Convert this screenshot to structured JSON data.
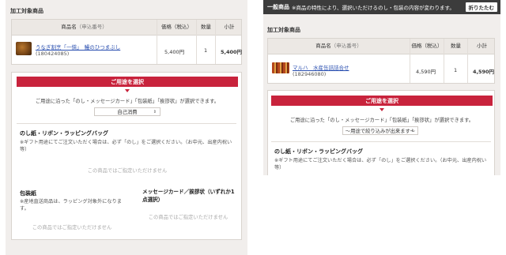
{
  "left": {
    "section_title": "加工対象商品",
    "table": {
      "headers": {
        "product": "商品名",
        "product_sub": "（申込番号）",
        "price": "価格（税込）",
        "qty": "数量",
        "subtotal": "小計"
      },
      "row": {
        "name": "うなぎ割烹「一愼」　鰻のひつまぶし",
        "code": "(180424085)",
        "price": "5,400円",
        "qty": "1",
        "subtotal": "5,400円"
      }
    },
    "purpose": {
      "button": "ご用途を選択",
      "description": "ご用途に沿った「のし・メッセージカード」「包装紙」「挨拶状」が選択できます。",
      "select_value": "自己消費"
    },
    "noshi": {
      "heading": "のし紙・リボン・ラッピングバッグ",
      "note": "※ギフト用途にてご注文いただく場合は、必ず「のし」をご選択ください。（お中元、出産内祝い等）",
      "unavailable": "この商品ではご指定いただけません"
    },
    "wrapping": {
      "heading": "包装紙",
      "note": "※産地直送商品は、ラッピング対象外になります。",
      "unavailable": "この商品ではご指定いただけません"
    },
    "message_card": {
      "heading": "メッセージカード／挨拶状（いずれか1点選択）",
      "unavailable": "この商品ではご指定いただけません"
    }
  },
  "right": {
    "topbar": {
      "label": "一般商品",
      "message": "※商品の特性により、選択いただけるのし・包装の内容が変わります。",
      "fold_button": "折りたたむ"
    },
    "section_title": "加工対象商品",
    "table": {
      "headers": {
        "product": "商品名",
        "product_sub": "（申込番号）",
        "price": "価格（税込）",
        "qty": "数量",
        "subtotal": "小計"
      },
      "row": {
        "name": "マルハ　水産缶詰詰合せ",
        "code": "(182946080)",
        "price": "4,590円",
        "qty": "1",
        "subtotal": "4,590円"
      }
    },
    "purpose": {
      "button": "ご用途を選択",
      "description": "ご用途に沿った「のし・メッセージカード」「包装紙」「挨拶状」が選択できます。",
      "select_value": "〜用途で絞り込みが出来ます〜"
    },
    "noshi": {
      "heading": "のし紙・リボン・ラッピングバッグ",
      "note": "※ギフト用途にてご注文いただく場合は、必ず「のし」をご選択ください。（お中元、出産内祝い等）"
    }
  },
  "colors": {
    "accent_red": "#c8233c",
    "panel_bg": "#f1eeec",
    "link_blue": "#2a4fb0",
    "topbar_dark": "#3c3c3c"
  }
}
